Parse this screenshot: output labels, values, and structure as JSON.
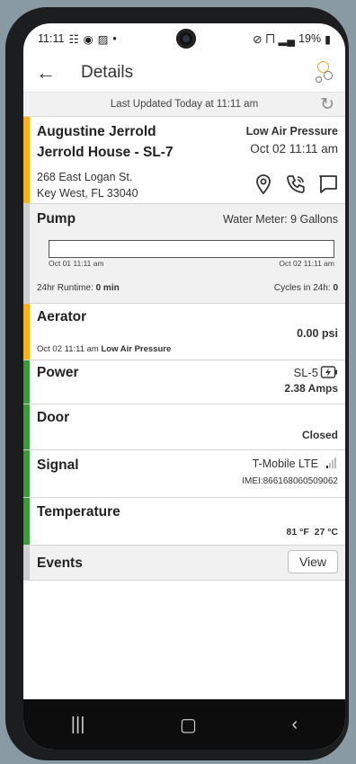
{
  "status": {
    "time": "11:11",
    "battery": "19%"
  },
  "appbar": {
    "title": "Details"
  },
  "updated": {
    "text": "Last Updated Today at 11:11 am"
  },
  "site": {
    "name": "Augustine Jerrold",
    "house": "Jerrold House - SL-7",
    "address_line1": "268 East Logan St.",
    "address_line2": "Key West, FL 33040",
    "alarm": "Low Air Pressure",
    "alarm_time": "Oct 02 11:11 am"
  },
  "pump": {
    "label": "Pump",
    "water_meter": "Water Meter: 9 Gallons",
    "timeline_start": "Oct 01 11:11 am",
    "timeline_end": "Oct 02 11:11 am",
    "runtime_label": "24hr Runtime: ",
    "runtime_value": "0 min",
    "cycles_label": "Cycles in 24h: ",
    "cycles_value": "0"
  },
  "aerator": {
    "label": "Aerator",
    "pressure": "0.00 psi",
    "status_time": "Oct 02 11:11 am ",
    "status": "Low Air Pressure"
  },
  "power": {
    "label": "Power",
    "source": "SL-5",
    "amps": "2.38 Amps"
  },
  "door": {
    "label": "Door",
    "value": "Closed"
  },
  "signal": {
    "label": "Signal",
    "carrier": "T-Mobile LTE",
    "imei": "IMEI:866168060509062"
  },
  "temperature": {
    "label": "Temperature",
    "fahrenheit": "81 °F",
    "celsius": "27 °C"
  },
  "events": {
    "label": "Events",
    "view_label": "View"
  },
  "colors": {
    "alarm": "#f5b21b",
    "ok": "#3c9a3c",
    "neutral": "#cfcfcf"
  }
}
